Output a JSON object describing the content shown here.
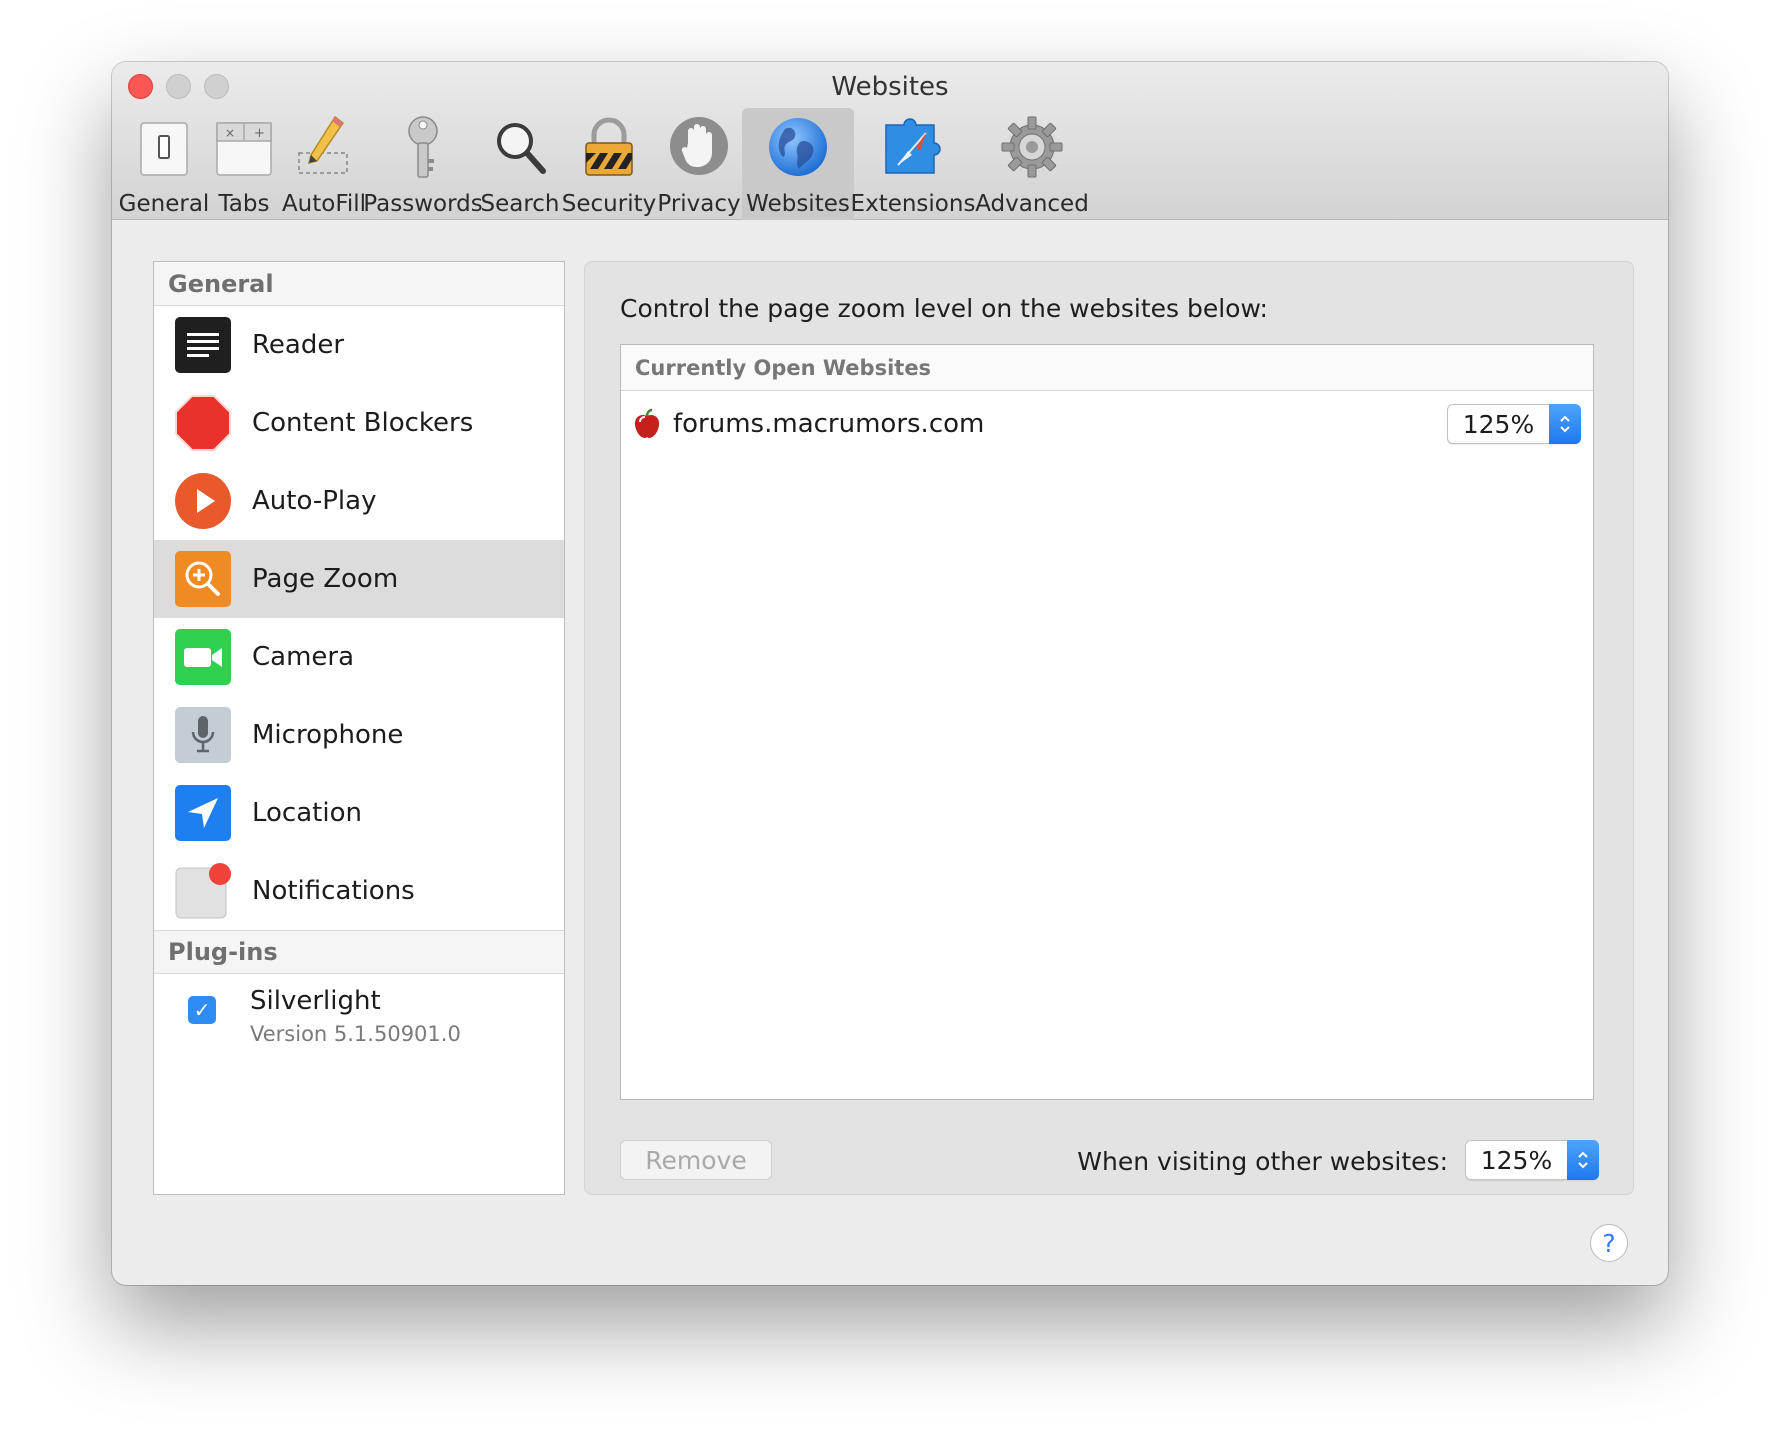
{
  "window": {
    "title": "Websites"
  },
  "toolbar": {
    "items": [
      {
        "label": "General",
        "icon": "general-icon"
      },
      {
        "label": "Tabs",
        "icon": "tabs-icon"
      },
      {
        "label": "AutoFill",
        "icon": "autofill-icon"
      },
      {
        "label": "Passwords",
        "icon": "passwords-icon"
      },
      {
        "label": "Search",
        "icon": "search-icon"
      },
      {
        "label": "Security",
        "icon": "security-icon"
      },
      {
        "label": "Privacy",
        "icon": "privacy-icon"
      },
      {
        "label": "Websites",
        "icon": "websites-icon",
        "selected": true
      },
      {
        "label": "Extensions",
        "icon": "extensions-icon"
      },
      {
        "label": "Advanced",
        "icon": "advanced-icon"
      }
    ]
  },
  "sidebar": {
    "general_header": "General",
    "items": [
      {
        "label": "Reader",
        "icon": "reader-icon"
      },
      {
        "label": "Content Blockers",
        "icon": "content-blockers-icon"
      },
      {
        "label": "Auto-Play",
        "icon": "auto-play-icon"
      },
      {
        "label": "Page Zoom",
        "icon": "page-zoom-icon",
        "selected": true
      },
      {
        "label": "Camera",
        "icon": "camera-icon"
      },
      {
        "label": "Microphone",
        "icon": "microphone-icon"
      },
      {
        "label": "Location",
        "icon": "location-icon"
      },
      {
        "label": "Notifications",
        "icon": "notifications-icon"
      }
    ],
    "plugins_header": "Plug-ins",
    "plugins": [
      {
        "name": "Silverlight",
        "version": "Version 5.1.50901.0",
        "enabled": true
      }
    ]
  },
  "main": {
    "description": "Control the page zoom level on the websites below:",
    "table_header": "Currently Open Websites",
    "sites": [
      {
        "name": "forums.macrumors.com",
        "zoom": "125%",
        "icon": "macrumors-favicon-icon"
      }
    ],
    "remove_label": "Remove",
    "other_label": "When visiting other websites:",
    "other_zoom": "125%"
  },
  "help_label": "?",
  "colors": {
    "accent": "#2f8cf5",
    "close": "#fc5753",
    "selected_row": "#dcdcdc"
  }
}
